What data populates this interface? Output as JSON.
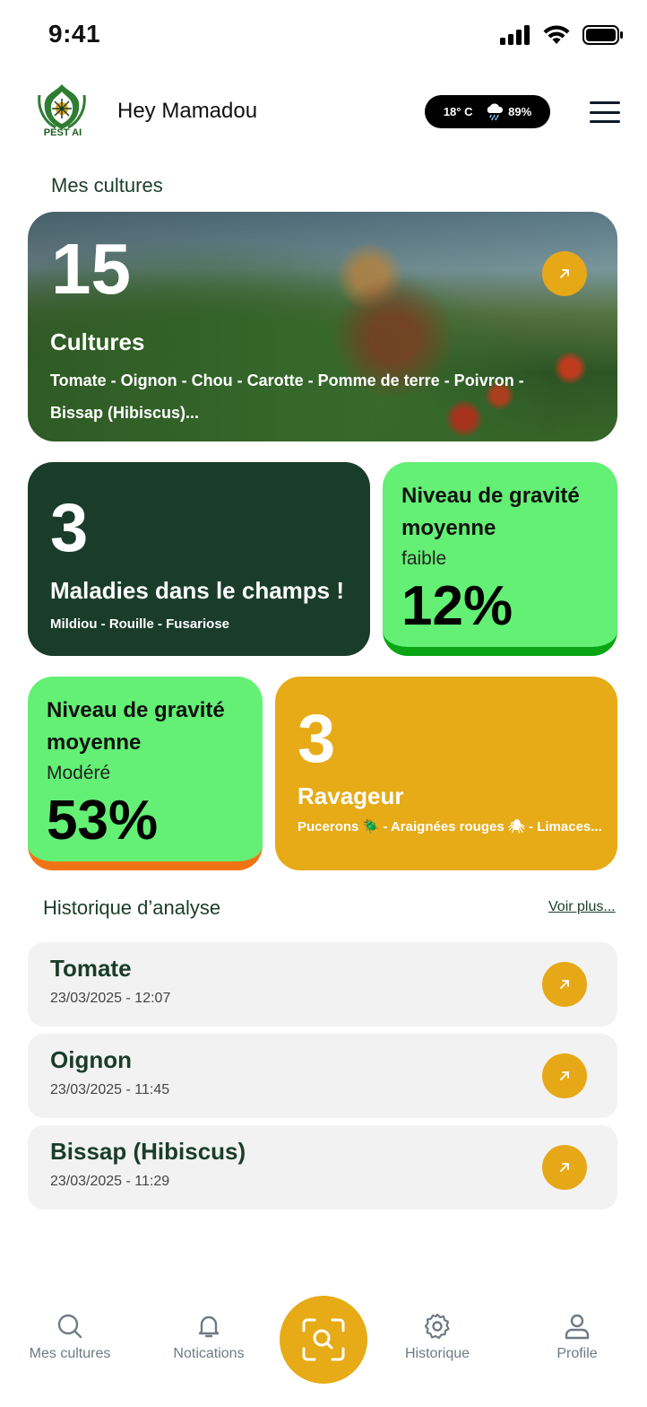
{
  "status_bar": {
    "time": "9:41"
  },
  "header": {
    "logo_text": "PEST AI",
    "greeting": "Hey Mamadou",
    "weather": {
      "temperature": "18° C",
      "humidity": "89%"
    }
  },
  "crops_section": {
    "title": "Mes cultures",
    "hero": {
      "count": "15",
      "label": "Cultures",
      "list": "Tomate - Oignon - Chou - Carotte - Pomme de terre - Poivron - Bissap (Hibiscus)..."
    }
  },
  "stats": {
    "diseases": {
      "count": "3",
      "label": "Maladies dans le champs !",
      "list": "Mildiou - Rouille - Fusariose"
    },
    "severity_low": {
      "title": "Niveau de gravité moyenne",
      "level": "faible",
      "percent": "12%",
      "accent": "#0aa515"
    },
    "severity_moderate": {
      "title": "Niveau de gravité moyenne",
      "level": "Modéré",
      "percent": "53%",
      "accent": "#f07414"
    },
    "pests": {
      "count": "3",
      "label": "Ravageur",
      "list": "Pucerons 🪲 - Araignées rouges 🕷 - Limaces..."
    }
  },
  "history": {
    "title": "Historique d’analyse",
    "see_more": "Voir plus...",
    "items": [
      {
        "name": "Tomate",
        "date": "23/03/2025 - 12:07"
      },
      {
        "name": "Oignon",
        "date": "23/03/2025 - 11:45"
      },
      {
        "name": "Bissap (Hibiscus)",
        "date": "23/03/2025 - 11:29"
      }
    ]
  },
  "bottom_nav": {
    "items": [
      {
        "label": "Mes cultures",
        "icon": "search-icon"
      },
      {
        "label": "Notications",
        "icon": "bell-icon"
      },
      {
        "label": "Historique",
        "icon": "gear-icon"
      },
      {
        "label": "Profile",
        "icon": "user-icon"
      }
    ],
    "scan_icon": "scan-search-icon"
  },
  "colors": {
    "primary_dark": "#1a3d2b",
    "accent_yellow": "#e6ab17",
    "accent_green": "#63f074"
  }
}
